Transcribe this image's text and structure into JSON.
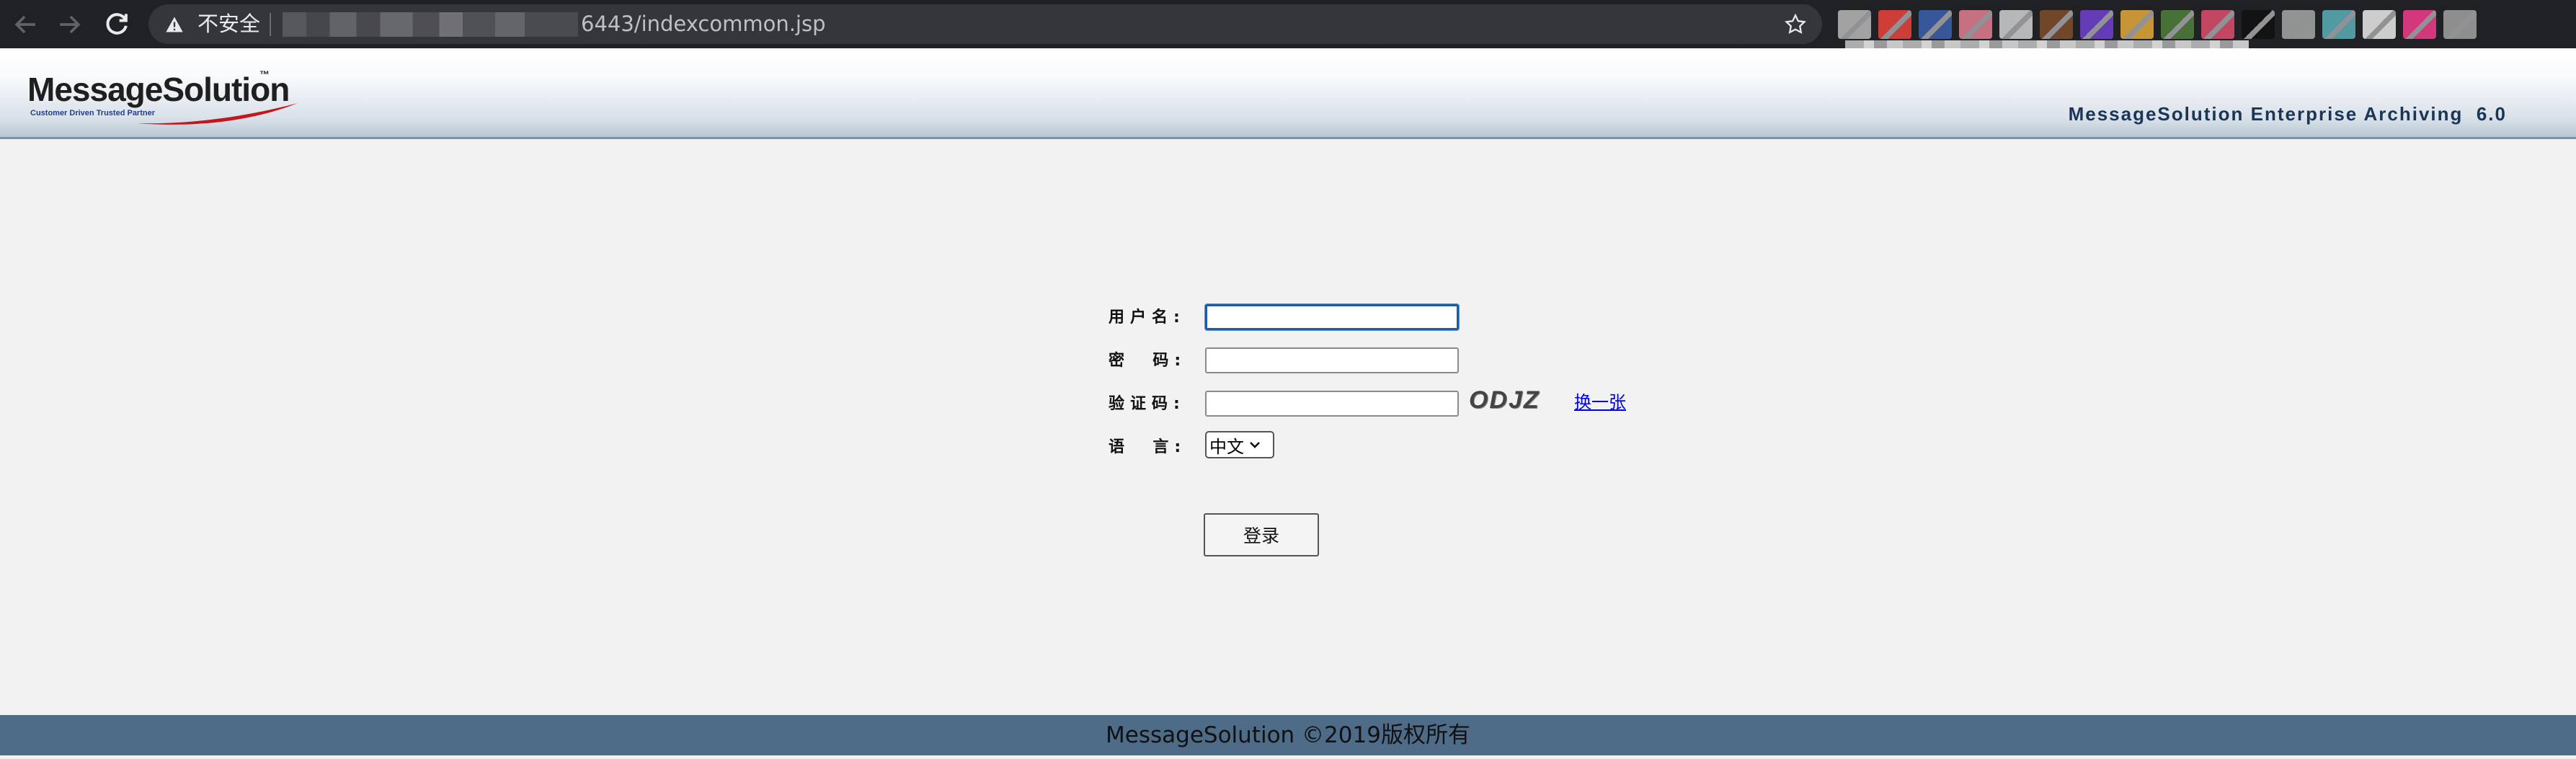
{
  "browser": {
    "security_label": "不安全",
    "url_visible": "6443/indexcommon.jsp",
    "extension_icon_colors": [
      "#b0b0b0",
      "#e0413b",
      "#3a5da8",
      "#d77a8c",
      "#c8c8c8",
      "#7a4a2a",
      "#6b3fc7",
      "#d8a238",
      "#4d7a3a",
      "#d44b6a",
      "#111111",
      "#a0a0a0",
      "#56a7b0",
      "#e0e0e0",
      "#e83b86",
      "#9a9a9a"
    ]
  },
  "header": {
    "logo_text": "MessageSolution",
    "logo_tm": "™",
    "logo_tagline": "Customer Driven  Trusted Partner",
    "product_name": "MessageSolution Enterprise Archiving  6.0"
  },
  "form": {
    "username_label": "用户名:",
    "username_value": "",
    "password_label": "密  码:",
    "password_value": "",
    "captcha_label": "验证码:",
    "captcha_value": "",
    "captcha_text": "ODJZ",
    "captcha_refresh": "换一张",
    "language_label": "语  言:",
    "language_selected": "中文",
    "submit_label": "登录"
  },
  "footer": {
    "copyright": "MessageSolution ©2019版权所有"
  },
  "colors": {
    "page_background": "#f2f2f2",
    "footer_background": "#4e6b87",
    "product_name_color": "#1b3556",
    "link_color": "#0000ee"
  }
}
